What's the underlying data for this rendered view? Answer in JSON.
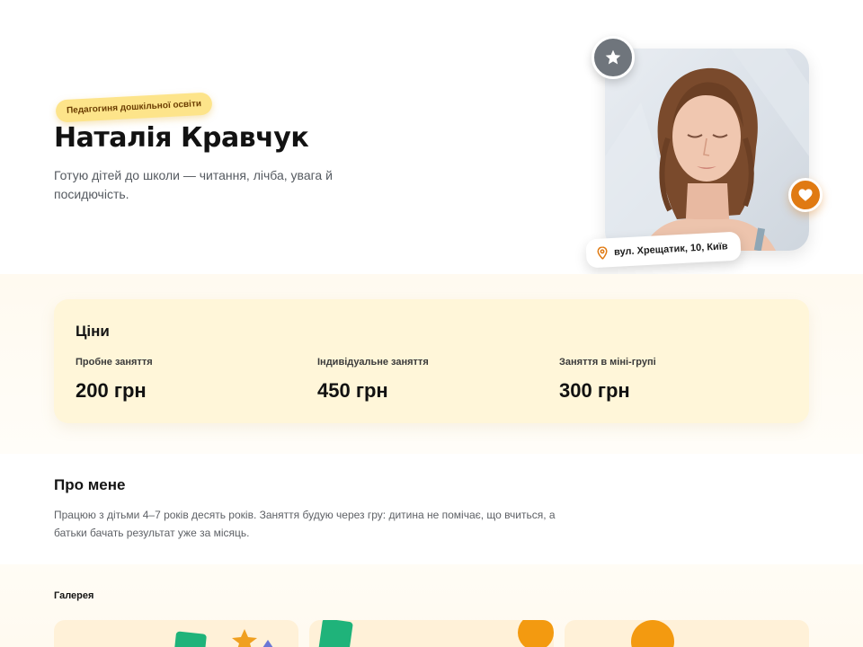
{
  "profile": {
    "badge": "Педагогиня дошкільної освіти",
    "name": "Наталія Кравчук",
    "tagline": "Готую дітей до школи — читання, лічба, увага й посидючість.",
    "address": "вул. Хрещатик, 10, Київ",
    "icons": {
      "top": "star-icon",
      "side": "heart-icon",
      "address": "map-pin-icon"
    }
  },
  "prices": {
    "title": "Ціни",
    "items": [
      {
        "label": "Пробне заняття",
        "value": "200 грн"
      },
      {
        "label": "Індивідуальне заняття",
        "value": "450 грн"
      },
      {
        "label": "Заняття в міні-групі",
        "value": "300 грн"
      }
    ]
  },
  "about": {
    "title": "Про мене",
    "text": "Працюю з дітьми 4–7 років десять років. Заняття будую через гру: дитина не помічає, що вчиться, а батьки бачать результат уже за місяць."
  },
  "gallery": {
    "title": "Галерея"
  },
  "colors": {
    "accent": "#e07a12",
    "badge_bg": "#fde48a",
    "price_card_bg": "#fff6d9",
    "star_badge_bg": "#6f757c"
  }
}
